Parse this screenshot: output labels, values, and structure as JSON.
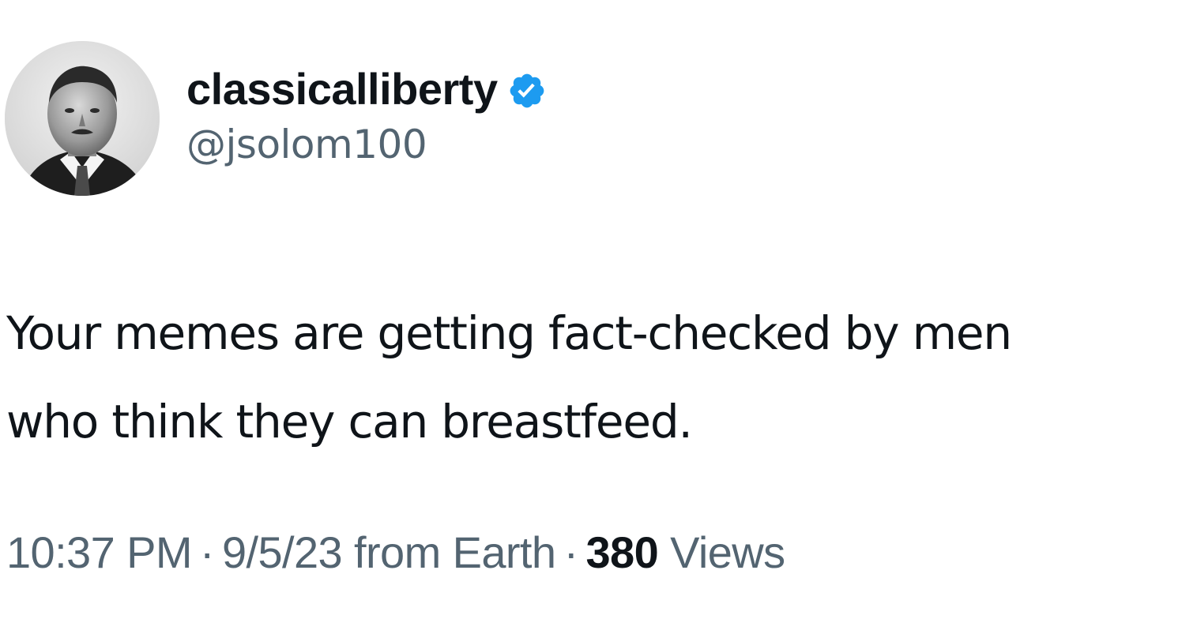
{
  "author": {
    "display_name": "classicalliberty",
    "handle": "@jsolom100",
    "verified": true,
    "verified_color": "#1d9bf0",
    "avatar_icon": "avatar-portrait"
  },
  "tweet": {
    "text": "Your memes are getting fact-checked by men\nwho think they can breastfeed."
  },
  "meta": {
    "time": "10:37 PM",
    "separator": "·",
    "date_location": "9/5/23 from Earth",
    "views_count": "380",
    "views_label": "Views"
  },
  "colors": {
    "text_primary": "#0f1419",
    "text_secondary": "#536471",
    "accent": "#1d9bf0"
  }
}
